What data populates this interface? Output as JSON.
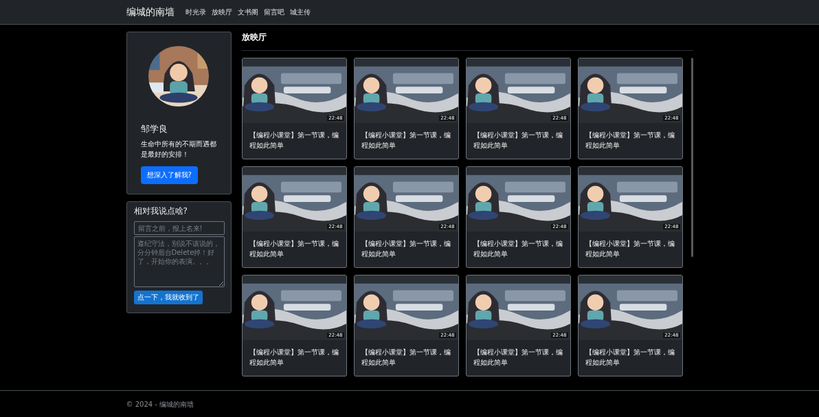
{
  "navbar": {
    "brand": "编城的南墙",
    "links": [
      {
        "label": "时光录"
      },
      {
        "label": "放映厅"
      },
      {
        "label": "文书阁"
      },
      {
        "label": "留言吧"
      },
      {
        "label": "城主传"
      }
    ]
  },
  "profile": {
    "name": "邹学良",
    "motto": "生命中所有的不期而遇都是最好的安排！",
    "button": "想深入了解我?"
  },
  "comment_form": {
    "title": "相对我说点啥?",
    "name_field": {
      "placeholder": "留言之前，报上名来!"
    },
    "message_field": {
      "placeholder": "遵纪守法，别说不该说的，分分钟后台Delete掉！好了，开始你的表演。。。"
    },
    "submit": "点一下，我就收到了"
  },
  "section_title": "放映厅",
  "videos": [
    {
      "title": "【编程小课堂】第一节课，编程如此简单",
      "duration": "22:48"
    },
    {
      "title": "【编程小课堂】第一节课，编程如此简单",
      "duration": "22:48"
    },
    {
      "title": "【编程小课堂】第一节课，编程如此简单",
      "duration": "22:48"
    },
    {
      "title": "【编程小课堂】第一节课，编程如此简单",
      "duration": "22:48"
    },
    {
      "title": "【编程小课堂】第一节课，编程如此简单",
      "duration": "22:48"
    },
    {
      "title": "【编程小课堂】第一节课，编程如此简单",
      "duration": "22:48"
    },
    {
      "title": "【编程小课堂】第一节课，编程如此简单",
      "duration": "22:48"
    },
    {
      "title": "【编程小课堂】第一节课，编程如此简单",
      "duration": "22:48"
    },
    {
      "title": "【编程小课堂】第一节课，编程如此简单",
      "duration": "22:48"
    },
    {
      "title": "【编程小课堂】第一节课，编程如此简单",
      "duration": "22:48"
    },
    {
      "title": "【编程小课堂】第一节课，编程如此简单",
      "duration": "22:48"
    },
    {
      "title": "【编程小课堂】第一节课，编程如此简单",
      "duration": "22:48"
    }
  ],
  "footer": "© 2024 - 编城的南墙"
}
